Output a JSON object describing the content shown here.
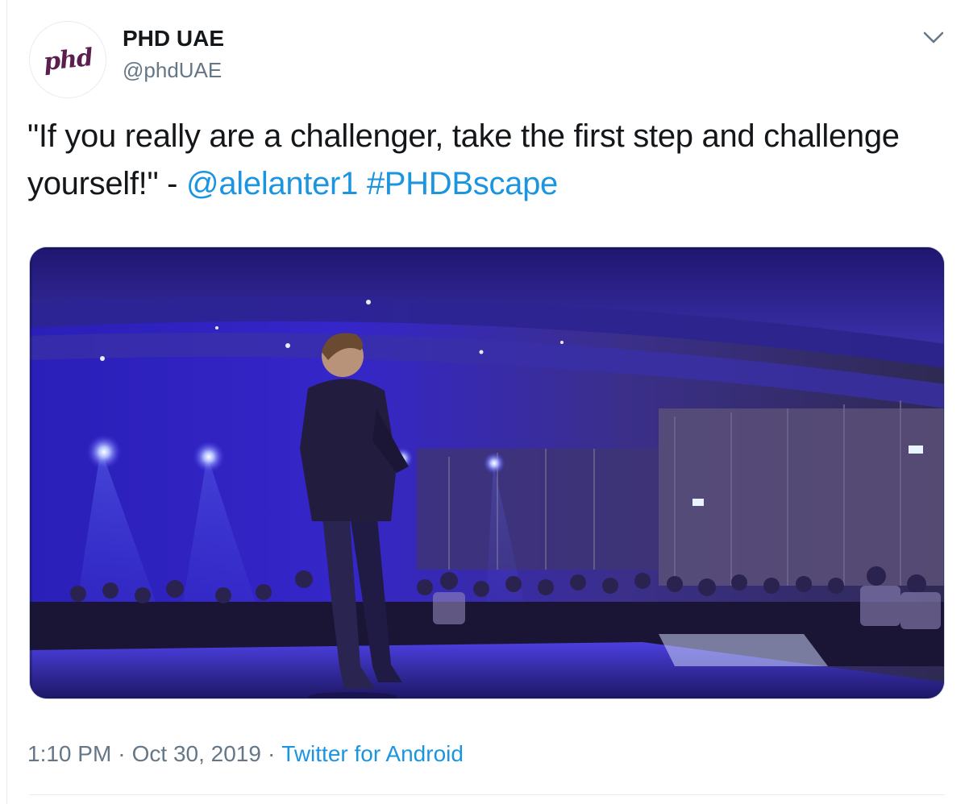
{
  "author": {
    "display_name": "PHD UAE",
    "handle": "@phdUAE",
    "avatar_logo_text": "phd"
  },
  "tweet": {
    "text_part1": "\"If you really are a challenger, take the first step and challenge yourself!\" - ",
    "mention": "@alelanter1",
    "hashtag": "#PHDBscape"
  },
  "media": {
    "icon": "photo-stage-speaker"
  },
  "meta": {
    "time": "1:10 PM",
    "date": "Oct 30, 2019",
    "separator": "·",
    "source": "Twitter for Android"
  },
  "colors": {
    "link": "#1b95e0",
    "muted": "#657786",
    "text": "#14171a",
    "brand": "#5b1f4f"
  },
  "icons": {
    "caret": "chevron-down-icon"
  }
}
